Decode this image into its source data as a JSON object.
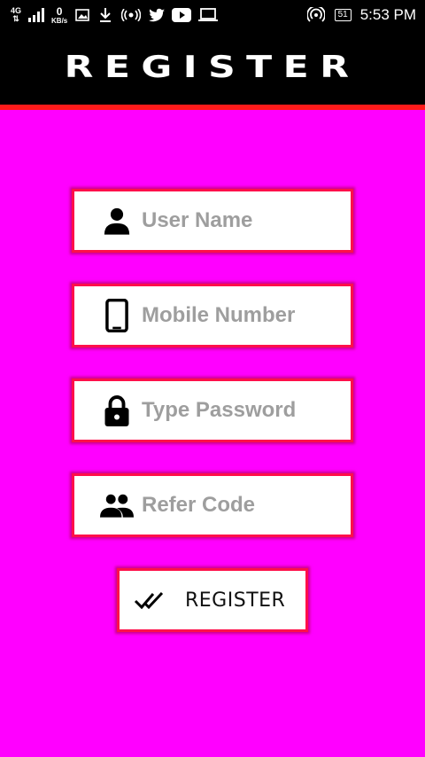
{
  "status_bar": {
    "network": "4G",
    "data_rate_value": "0",
    "data_rate_unit": "KB/s",
    "battery": "51",
    "time": "5:53 PM"
  },
  "header": {
    "title": "REGISTER"
  },
  "form": {
    "username": {
      "placeholder": "User Name",
      "value": ""
    },
    "mobile": {
      "placeholder": "Mobile Number",
      "value": ""
    },
    "password": {
      "placeholder": "Type Password",
      "value": ""
    },
    "refer": {
      "placeholder": "Refer Code",
      "value": ""
    },
    "register_label": "REGISTER"
  },
  "colors": {
    "background": "#ff00ff",
    "field_border": "#ff0f4a",
    "header_bg": "#000000",
    "header_strip": "#ff1a1a",
    "placeholder": "#9e9e9e"
  }
}
